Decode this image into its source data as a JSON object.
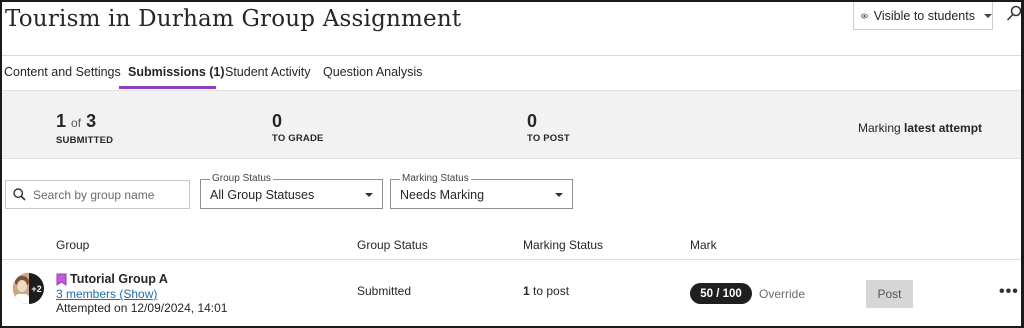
{
  "header": {
    "title": "Tourism in Durham Group Assignment",
    "visibility_label": "Visible to students"
  },
  "tabs": [
    {
      "label": "Content and Settings",
      "active": false
    },
    {
      "label": "Submissions (1)",
      "active": true
    },
    {
      "label": "Student Activity",
      "active": false
    },
    {
      "label": "Question Analysis",
      "active": false
    }
  ],
  "stats": {
    "submitted": {
      "count": "1",
      "of_text": "of",
      "total": "3",
      "label": "SUBMITTED"
    },
    "to_grade": {
      "count": "0",
      "label": "TO GRADE"
    },
    "to_post": {
      "count": "0",
      "label": "TO POST"
    },
    "marking_prefix": "Marking",
    "marking_mode": "latest attempt"
  },
  "filters": {
    "search_placeholder": "Search by group name",
    "group_status": {
      "legend": "Group Status",
      "value": "All Group Statuses"
    },
    "marking_status": {
      "legend": "Marking Status",
      "value": "Needs Marking"
    }
  },
  "table": {
    "headers": {
      "group": "Group",
      "group_status": "Group Status",
      "marking_status": "Marking Status",
      "mark": "Mark"
    },
    "rows": [
      {
        "avatar_extra": "+2",
        "group_name": "Tutorial Group A",
        "members_link": "3 members (Show)",
        "attempted": "Attempted on 12/09/2024, 14:01",
        "group_status": "Submitted",
        "marking_count": "1",
        "marking_suffix": "to post",
        "mark": "50 / 100",
        "override_label": "Override",
        "post_label": "Post",
        "more_label": "•••"
      }
    ]
  },
  "colors": {
    "accent": "#8b3fbd",
    "link": "#1a6ea8",
    "mark_pill": "#1f1f1f",
    "stats_band": "#f2f2f2"
  }
}
